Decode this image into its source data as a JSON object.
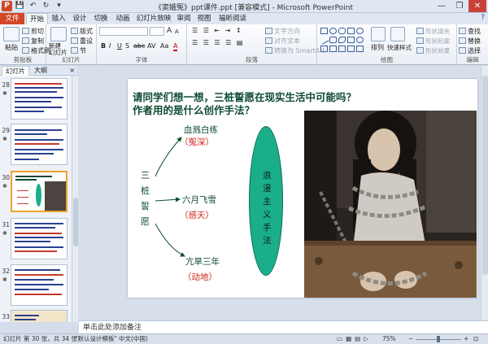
{
  "app": {
    "window_title": "《窦娥冤》ppt课件.ppt [兼容模式] - Microsoft PowerPoint",
    "app_icon": "P"
  },
  "quick_access": {
    "save_icon": "💾",
    "undo_icon": "↶",
    "redo_icon": "↻",
    "more_icon": "▾"
  },
  "window_controls": {
    "minimize": "—",
    "restore": "❐",
    "close": "✕"
  },
  "tabs": [
    "文件",
    "开始",
    "插入",
    "设计",
    "切换",
    "动画",
    "幻灯片放映",
    "审阅",
    "视图",
    "福昕阅读器"
  ],
  "help_icon": "?",
  "ribbon": {
    "clipboard": {
      "label": "剪贴板",
      "paste": "粘贴",
      "cut": "剪切",
      "copy": "复制",
      "format_painter": "格式刷"
    },
    "slides": {
      "label": "幻灯片",
      "new_slide": "新建\n幻灯片",
      "layout": "版式",
      "reset": "重设",
      "section": "节"
    },
    "font": {
      "label": "字体",
      "grow": "A",
      "shrink": "A",
      "bold": "B",
      "italic": "I",
      "underline": "U",
      "strike": "S",
      "shadow": "abc",
      "spacing": "AV",
      "case": "Aa",
      "color": "A"
    },
    "paragraph": {
      "label": "段落",
      "text_direction": "文字方向",
      "align_text": "对齐文本",
      "smartart": "转换为 SmartArt"
    },
    "drawing": {
      "label": "绘图",
      "arrange": "排列",
      "quick_styles": "快速样式",
      "shape_fill": "形状填充",
      "shape_outline": "形状轮廓",
      "shape_effects": "形状效果"
    },
    "editing": {
      "label": "编辑",
      "find": "查找",
      "replace": "替换",
      "select": "选择"
    }
  },
  "panel": {
    "tab_slides": "幻灯片",
    "tab_outline": "大纲",
    "close": "×"
  },
  "thumbnails": [
    {
      "num": "28",
      "star": "✱"
    },
    {
      "num": "29",
      "star": "✱"
    },
    {
      "num": "30",
      "star": "✱"
    },
    {
      "num": "31",
      "star": "✱"
    },
    {
      "num": "32",
      "star": "✱"
    },
    {
      "num": "33",
      "star": "✱"
    }
  ],
  "slide": {
    "title_line1": "请同学们想一想，三桩誓愿在现实生活中可能吗？",
    "title_line2": "作者用的是什么创作手法？",
    "vertical_label": [
      "三",
      "桩",
      "誓",
      "愿"
    ],
    "items": [
      {
        "cn": "血溅白练",
        "red": "（冤深）"
      },
      {
        "cn": "六月飞雪",
        "red": "（感天）"
      },
      {
        "cn": "亢旱三年",
        "red": "（动地）"
      }
    ],
    "ellipse_text": [
      "浪",
      "漫",
      "主",
      "义",
      "手",
      "法"
    ]
  },
  "notes_placeholder": "单击此处添加备注",
  "status": {
    "slide_info": "幻灯片 第 30 张，共 34 张",
    "theme": "\"默认设计模板\"",
    "language": "中文(中国)",
    "zoom": "75%",
    "zoom_out": "−",
    "zoom_in": "+"
  },
  "colors": {
    "file_tab": "#d24726",
    "title_text": "#0d4b31",
    "red_text": "#d0251a",
    "ellipse": "#1bae8a",
    "selected_thumb": "#f0a030"
  }
}
